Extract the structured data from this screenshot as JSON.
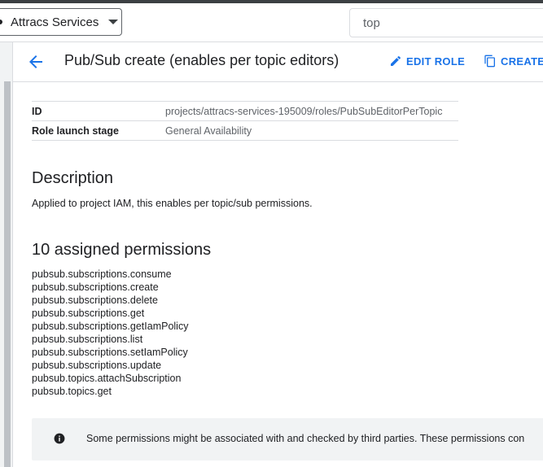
{
  "topbar": {
    "project_name": "Attracs Services",
    "search": {
      "value": "top",
      "placeholder": "top"
    }
  },
  "header": {
    "title": "Pub/Sub create (enables per topic editors)",
    "edit_role_label": "EDIT ROLE",
    "create_role_label": "CREATE R"
  },
  "details": {
    "rows": [
      {
        "key": "ID",
        "value": "projects/attracs-services-195009/roles/PubSubEditorPerTopic"
      },
      {
        "key": "Role launch stage",
        "value": "General Availability"
      }
    ]
  },
  "description": {
    "title": "Description",
    "text": "Applied to project IAM, this enables per topic/sub permissions."
  },
  "permissions": {
    "title": "10 assigned permissions",
    "items": [
      "pubsub.subscriptions.consume",
      "pubsub.subscriptions.create",
      "pubsub.subscriptions.delete",
      "pubsub.subscriptions.get",
      "pubsub.subscriptions.getIamPolicy",
      "pubsub.subscriptions.list",
      "pubsub.subscriptions.setIamPolicy",
      "pubsub.subscriptions.update",
      "pubsub.topics.attachSubscription",
      "pubsub.topics.get"
    ]
  },
  "notice": {
    "text": "Some permissions might be associated with and checked by third parties. These permissions con"
  },
  "colors": {
    "accent": "#1a73e8",
    "text": "#202124",
    "muted": "#5f6368",
    "divider": "#dadce0",
    "notice_bg": "#f1f3f4"
  },
  "icons": {
    "back": "arrow-back-icon",
    "edit": "pencil-icon",
    "create": "copy-icon",
    "notice": "info-icon",
    "project": "chevron-down-icon"
  }
}
